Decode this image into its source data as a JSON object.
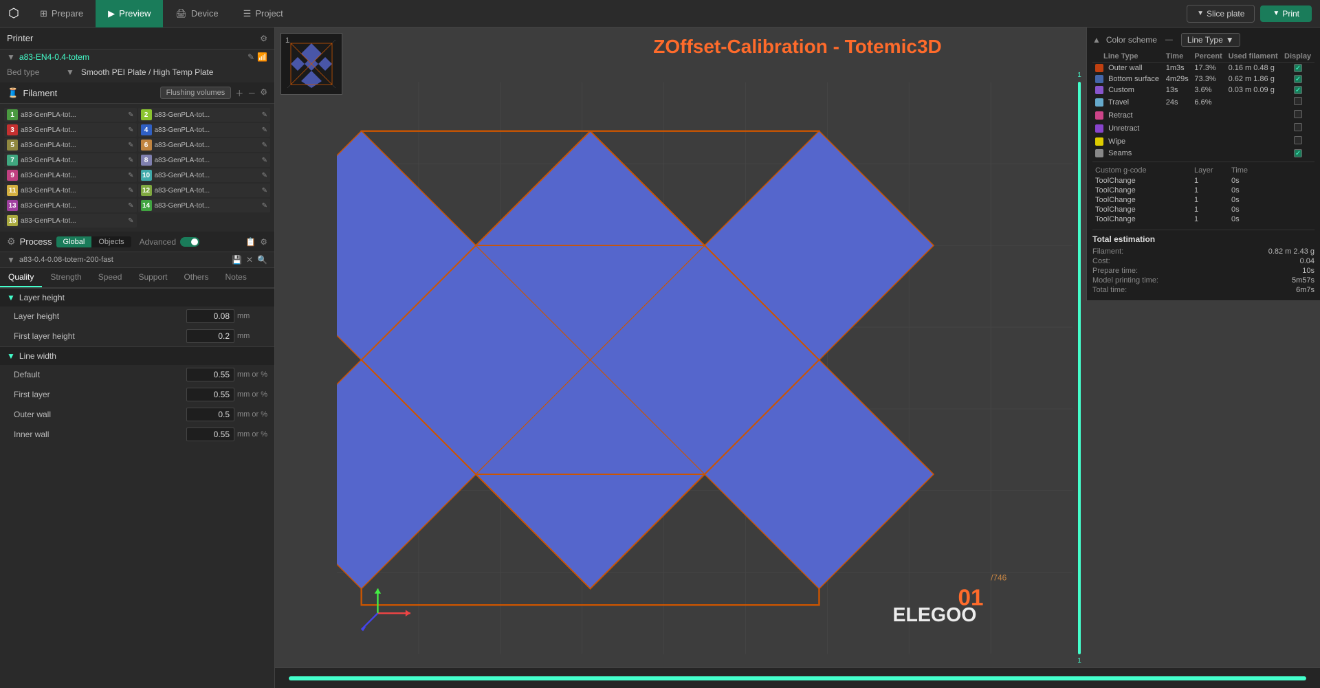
{
  "topbar": {
    "logo": "⬡",
    "tabs": [
      {
        "label": "Prepare",
        "icon": "⊞",
        "active": false
      },
      {
        "label": "Preview",
        "icon": "▷",
        "active": true
      },
      {
        "label": "Device",
        "icon": "⊟",
        "active": false
      },
      {
        "label": "Project",
        "icon": "☰",
        "active": false
      }
    ],
    "slice_label": "Slice plate",
    "print_label": "Print"
  },
  "printer": {
    "section_title": "Printer",
    "name": "a83-EN4-0.4-totem",
    "bed_label": "Bed type",
    "bed_value": "Smooth PEI Plate / High Temp Plate"
  },
  "filament": {
    "section_title": "Filament",
    "flush_button": "Flushing volumes",
    "items": [
      {
        "num": "1",
        "label": "a83-GenPLA-tot...",
        "color": "#4a9"
      },
      {
        "num": "2",
        "label": "a83-GenPLA-tot...",
        "color": "#8b4"
      },
      {
        "num": "3",
        "label": "a83-GenPLA-tot...",
        "color": "#a44"
      },
      {
        "num": "4",
        "label": "a83-GenPLA-tot...",
        "color": "#48a"
      },
      {
        "num": "5",
        "label": "a83-GenPLA-tot...",
        "color": "#884"
      },
      {
        "num": "6",
        "label": "a83-GenPLA-tot...",
        "color": "#a84"
      },
      {
        "num": "7",
        "label": "a83-GenPLA-tot...",
        "color": "#4a8"
      },
      {
        "num": "8",
        "label": "a83-GenPLA-tot...",
        "color": "#88a"
      },
      {
        "num": "9",
        "label": "a83-GenPLA-tot...",
        "color": "#a48"
      },
      {
        "num": "10",
        "label": "a83-GenPLA-tot...",
        "color": "#4aa"
      },
      {
        "num": "11",
        "label": "a83-GenPLA-tot...",
        "color": "#d4"
      },
      {
        "num": "12",
        "label": "a83-GenPLA-tot...",
        "color": "#8a4"
      },
      {
        "num": "13",
        "label": "a83-GenPLA-tot...",
        "color": "#a4a"
      },
      {
        "num": "14",
        "label": "a83-GenPLA-tot...",
        "color": "#4a4"
      },
      {
        "num": "15",
        "label": "a83-GenPLA-tot...",
        "color": "#aa4"
      }
    ]
  },
  "process": {
    "section_title": "Process",
    "global_label": "Global",
    "objects_label": "Objects",
    "advanced_label": "Advanced",
    "preset": "a83-0.4-0.08-totem-200-fast"
  },
  "quality_tabs": [
    "Quality",
    "Strength",
    "Speed",
    "Support",
    "Others",
    "Notes"
  ],
  "active_quality_tab": "Quality",
  "layer_height": {
    "group_title": "Layer height",
    "layer_height_label": "Layer height",
    "layer_height_value": "0.08",
    "layer_height_unit": "mm",
    "first_layer_label": "First layer height",
    "first_layer_value": "0.2",
    "first_layer_unit": "mm"
  },
  "line_width": {
    "group_title": "Line width",
    "default_label": "Default",
    "default_value": "0.55",
    "default_unit": "mm or %",
    "first_layer_label": "First layer",
    "first_layer_value": "0.55",
    "first_layer_unit": "mm or %",
    "outer_wall_label": "Outer wall",
    "outer_wall_value": "0.5",
    "outer_wall_unit": "mm or %",
    "inner_wall_label": "Inner wall",
    "inner_wall_value": "0.55",
    "inner_wall_unit": "mm or %"
  },
  "canvas": {
    "title": "ZOffset-Calibration - Totemic3D",
    "thumbnail_num": "1"
  },
  "color_scheme": {
    "header": "Color scheme",
    "dropdown": "Line Type",
    "columns": [
      "Line Type",
      "Time",
      "Percent",
      "Used filament",
      "Display"
    ],
    "rows": [
      {
        "color": "#c04010",
        "label": "Outer wall",
        "time": "1m3s",
        "percent": "17.3%",
        "filament": "0.16 m  0.48 g",
        "checked": true
      },
      {
        "color": "#4466aa",
        "label": "Bottom surface",
        "time": "4m29s",
        "percent": "73.3%",
        "filament": "0.62 m  1.86 g",
        "checked": true
      },
      {
        "color": "#8855cc",
        "label": "Custom",
        "time": "13s",
        "percent": "3.6%",
        "filament": "0.03 m  0.09 g",
        "checked": true
      },
      {
        "color": "#66aacc",
        "label": "Travel",
        "time": "24s",
        "percent": "6.6%",
        "filament": "",
        "checked": false
      },
      {
        "color": "#cc4488",
        "label": "Retract",
        "time": "",
        "percent": "",
        "filament": "",
        "checked": false
      },
      {
        "color": "#8844cc",
        "label": "Unretract",
        "time": "",
        "percent": "",
        "filament": "",
        "checked": false
      },
      {
        "color": "#ddcc00",
        "label": "Wipe",
        "time": "",
        "percent": "",
        "filament": "",
        "checked": false
      },
      {
        "color": "#888888",
        "label": "Seams",
        "time": "",
        "percent": "",
        "filament": "",
        "checked": true
      }
    ],
    "custom_gcode": {
      "sub_header": [
        "Custom g-code",
        "Layer",
        "Time"
      ],
      "rows": [
        {
          "label": "ToolChange",
          "layer": "1",
          "time": "0s"
        },
        {
          "label": "ToolChange",
          "layer": "1",
          "time": "0s"
        },
        {
          "label": "ToolChange",
          "layer": "1",
          "time": "0s"
        },
        {
          "label": "ToolChange",
          "layer": "1",
          "time": "0s"
        },
        {
          "label": "ToolChange",
          "layer": "1",
          "time": "0s"
        }
      ]
    },
    "estimation": {
      "title": "Total estimation",
      "filament_label": "Filament:",
      "filament_value": "0.82 m  2.43 g",
      "cost_label": "Cost:",
      "cost_value": "0.04",
      "prepare_label": "Prepare time:",
      "prepare_value": "10s",
      "model_label": "Model printing time:",
      "model_value": "5m57s",
      "total_label": "Total time:",
      "total_value": "6m7s"
    }
  },
  "layer_markers": {
    "top": "1",
    "bottom": "1"
  },
  "bottom_progress": 100,
  "logo_text": "ELEGOO",
  "layer_num": "01"
}
